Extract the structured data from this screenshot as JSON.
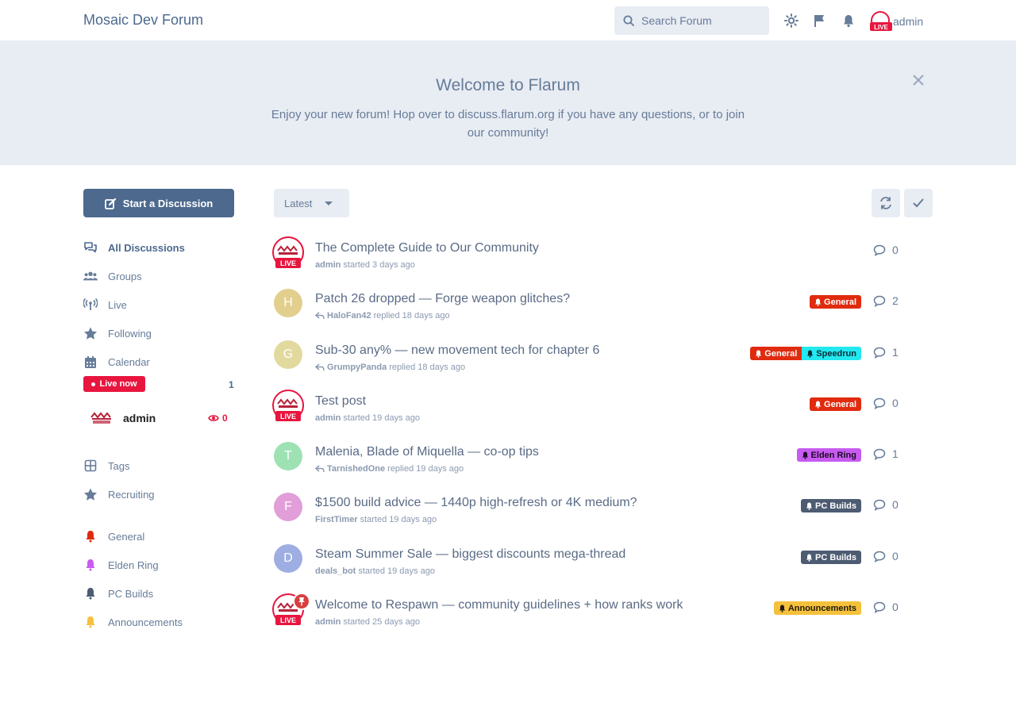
{
  "header": {
    "brand": "Mosaic Dev Forum",
    "search_placeholder": "Search Forum",
    "user_name": "admin",
    "live_badge": "LIVE"
  },
  "hero": {
    "title": "Welcome to Flarum",
    "description": "Enjoy your new forum! Hop over to discuss.flarum.org if you have any questions, or to join our community!"
  },
  "sidebar": {
    "start_button": "Start a Discussion",
    "nav": [
      {
        "label": "All Discussions",
        "icon": "discussions-icon"
      },
      {
        "label": "Groups",
        "icon": "users-icon"
      },
      {
        "label": "Live",
        "icon": "broadcast-icon"
      },
      {
        "label": "Following",
        "icon": "star-icon"
      },
      {
        "label": "Calendar",
        "icon": "calendar-icon"
      }
    ],
    "live_now": {
      "label": "Live now",
      "count": "1"
    },
    "stream": {
      "name": "admin",
      "views": "0"
    },
    "links": [
      {
        "label": "Tags",
        "icon": "tags-grid-icon"
      },
      {
        "label": "Recruiting",
        "icon": "star-icon"
      }
    ],
    "tags": [
      {
        "label": "General",
        "color": "#e02b0f"
      },
      {
        "label": "Elden Ring",
        "color": "#c85bf0"
      },
      {
        "label": "PC Builds",
        "color": "#4d5c72"
      },
      {
        "label": "Announcements",
        "color": "#f5c13c"
      }
    ]
  },
  "toolbar": {
    "sort_label": "Latest"
  },
  "discussions": [
    {
      "title": "The Complete Guide to Our Community",
      "user": "admin",
      "action": "started",
      "time": "3 days ago",
      "replies": "0",
      "avatar": "live",
      "tags": []
    },
    {
      "title": "Patch 26 dropped — Forge weapon glitches?",
      "user": "HaloFan42",
      "action": "replied",
      "time": "18 days ago",
      "replies": "2",
      "avatar": "H",
      "avatar_color": "#e2cf8e",
      "tags": [
        {
          "label": "General",
          "bg": "#e02b0f",
          "fg": "#ffffff"
        }
      ]
    },
    {
      "title": "Sub-30 any% — new movement tech for chapter 6",
      "user": "GrumpyPanda",
      "action": "replied",
      "time": "18 days ago",
      "replies": "1",
      "avatar": "G",
      "avatar_color": "#e2d99e",
      "tags": [
        {
          "label": "General",
          "bg": "#e02b0f",
          "fg": "#ffffff"
        },
        {
          "label": "Speedrun",
          "bg": "#22e8f0",
          "fg": "#0b2a36"
        }
      ]
    },
    {
      "title": "Test post",
      "user": "admin",
      "action": "started",
      "time": "19 days ago",
      "replies": "0",
      "avatar": "live",
      "tags": [
        {
          "label": "General",
          "bg": "#e02b0f",
          "fg": "#ffffff"
        }
      ]
    },
    {
      "title": "Malenia, Blade of Miquella — co-op tips",
      "user": "TarnishedOne",
      "action": "replied",
      "time": "19 days ago",
      "replies": "1",
      "avatar": "T",
      "avatar_color": "#9ee2b4",
      "tags": [
        {
          "label": "Elden Ring",
          "bg": "#c85bf0",
          "fg": "#1c0a26"
        }
      ]
    },
    {
      "title": "$1500 build advice — 1440p high-refresh or 4K medium?",
      "user": "FirstTimer",
      "action": "started",
      "time": "19 days ago",
      "replies": "0",
      "avatar": "F",
      "avatar_color": "#e29ed9",
      "tags": [
        {
          "label": "PC Builds",
          "bg": "#4d5c72",
          "fg": "#ffffff"
        }
      ]
    },
    {
      "title": "Steam Summer Sale — biggest discounts mega-thread",
      "user": "deals_bot",
      "action": "started",
      "time": "19 days ago",
      "replies": "0",
      "avatar": "D",
      "avatar_color": "#9eaee2",
      "tags": [
        {
          "label": "PC Builds",
          "bg": "#4d5c72",
          "fg": "#ffffff"
        }
      ]
    },
    {
      "title": "Welcome to Respawn — community guidelines + how ranks work",
      "user": "admin",
      "action": "started",
      "time": "25 days ago",
      "replies": "0",
      "avatar": "live",
      "pinned": true,
      "tags": [
        {
          "label": "Announcements",
          "bg": "#f5c13c",
          "fg": "#1f1a0a"
        }
      ]
    }
  ]
}
